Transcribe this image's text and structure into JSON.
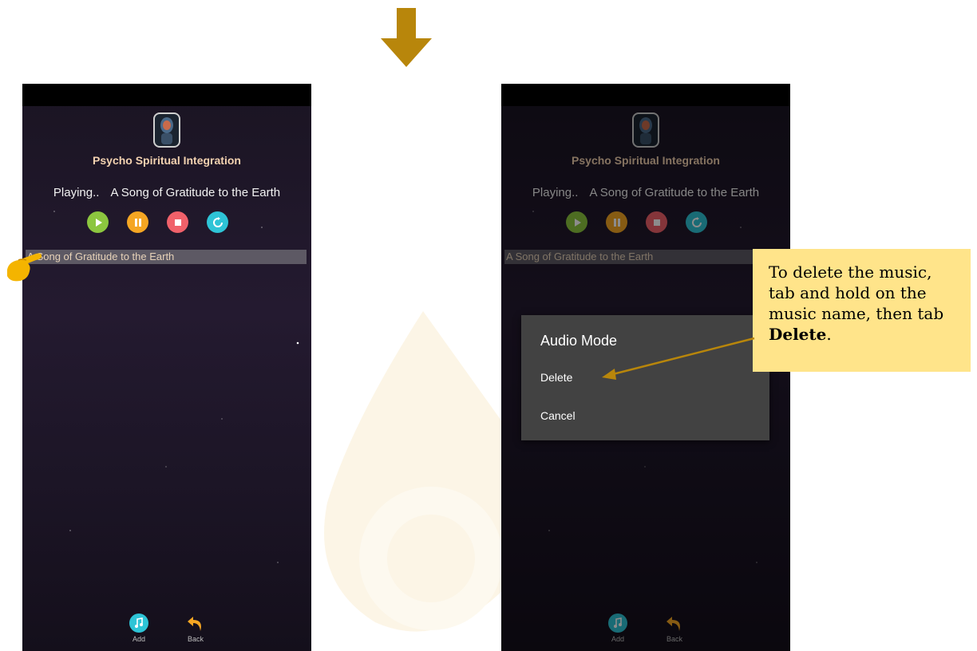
{
  "app": {
    "title": "Psycho Spiritual Integration",
    "playing_label": "Playing..",
    "playing_track": "A Song of Gratitude to the Earth"
  },
  "playlist": {
    "items": [
      "A Song of Gratitude to the Earth"
    ]
  },
  "controls": {
    "play_icon": "play-icon",
    "pause_icon": "pause-icon",
    "stop_icon": "stop-icon",
    "repeat_icon": "repeat-icon"
  },
  "bottom_bar": {
    "add_label": "Add",
    "back_label": "Back"
  },
  "dialog": {
    "title": "Audio Mode",
    "delete_label": "Delete",
    "cancel_label": "Cancel"
  },
  "callout": {
    "text_before": "To delete the music, tab and hold on the music name, then tab ",
    "text_bold": "Delete",
    "text_after": "."
  },
  "colors": {
    "accent_arrow": "#b8860b",
    "callout_bg": "#ffe48a",
    "play": "#8cc63f",
    "pause": "#f5a623",
    "stop": "#f0616a",
    "repeat": "#2ec4d6"
  }
}
